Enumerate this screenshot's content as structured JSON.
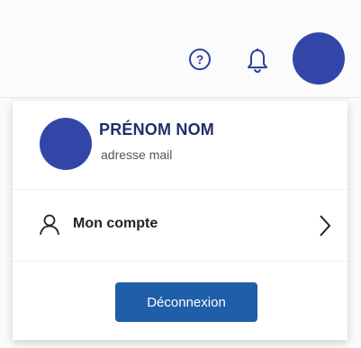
{
  "header": {
    "icons": [
      "help-circle-icon",
      "bell-icon",
      "avatar"
    ],
    "accent": "#3346a7"
  },
  "menu": {
    "user": {
      "name": "PRÉNOM NOM",
      "email": "adresse mail",
      "avatar_color": "#3346a7"
    },
    "account_item": {
      "label": "Mon compte",
      "icon": "user-icon"
    },
    "logout_label": "Déconnexion",
    "logout_color": "#1f5ea8"
  }
}
